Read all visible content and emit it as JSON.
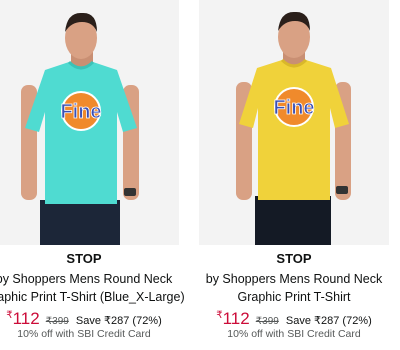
{
  "products": [
    {
      "brand": "STOP",
      "title_line1": "by Shoppers Mens Round Neck",
      "title_line2": "Graphic Print T-Shirt (Blue_X-Large)",
      "currency_symbol": "₹",
      "price": "112",
      "mrp": "₹399",
      "savings": "Save ₹287 (72%)",
      "offer": "10% off with SBI Credit Card",
      "logo_text": "Fine",
      "shirt_color": "#4fdbd1"
    },
    {
      "brand": "STOP",
      "title_line1": "by Shoppers Mens Round Neck",
      "title_line2": "Graphic Print T-Shirt",
      "currency_symbol": "₹",
      "price": "112",
      "mrp": "₹399",
      "savings": "Save ₹287 (72%)",
      "offer": "10% off with SBI Credit Card",
      "logo_text": "Fine",
      "shirt_color": "#f0d23a"
    }
  ]
}
